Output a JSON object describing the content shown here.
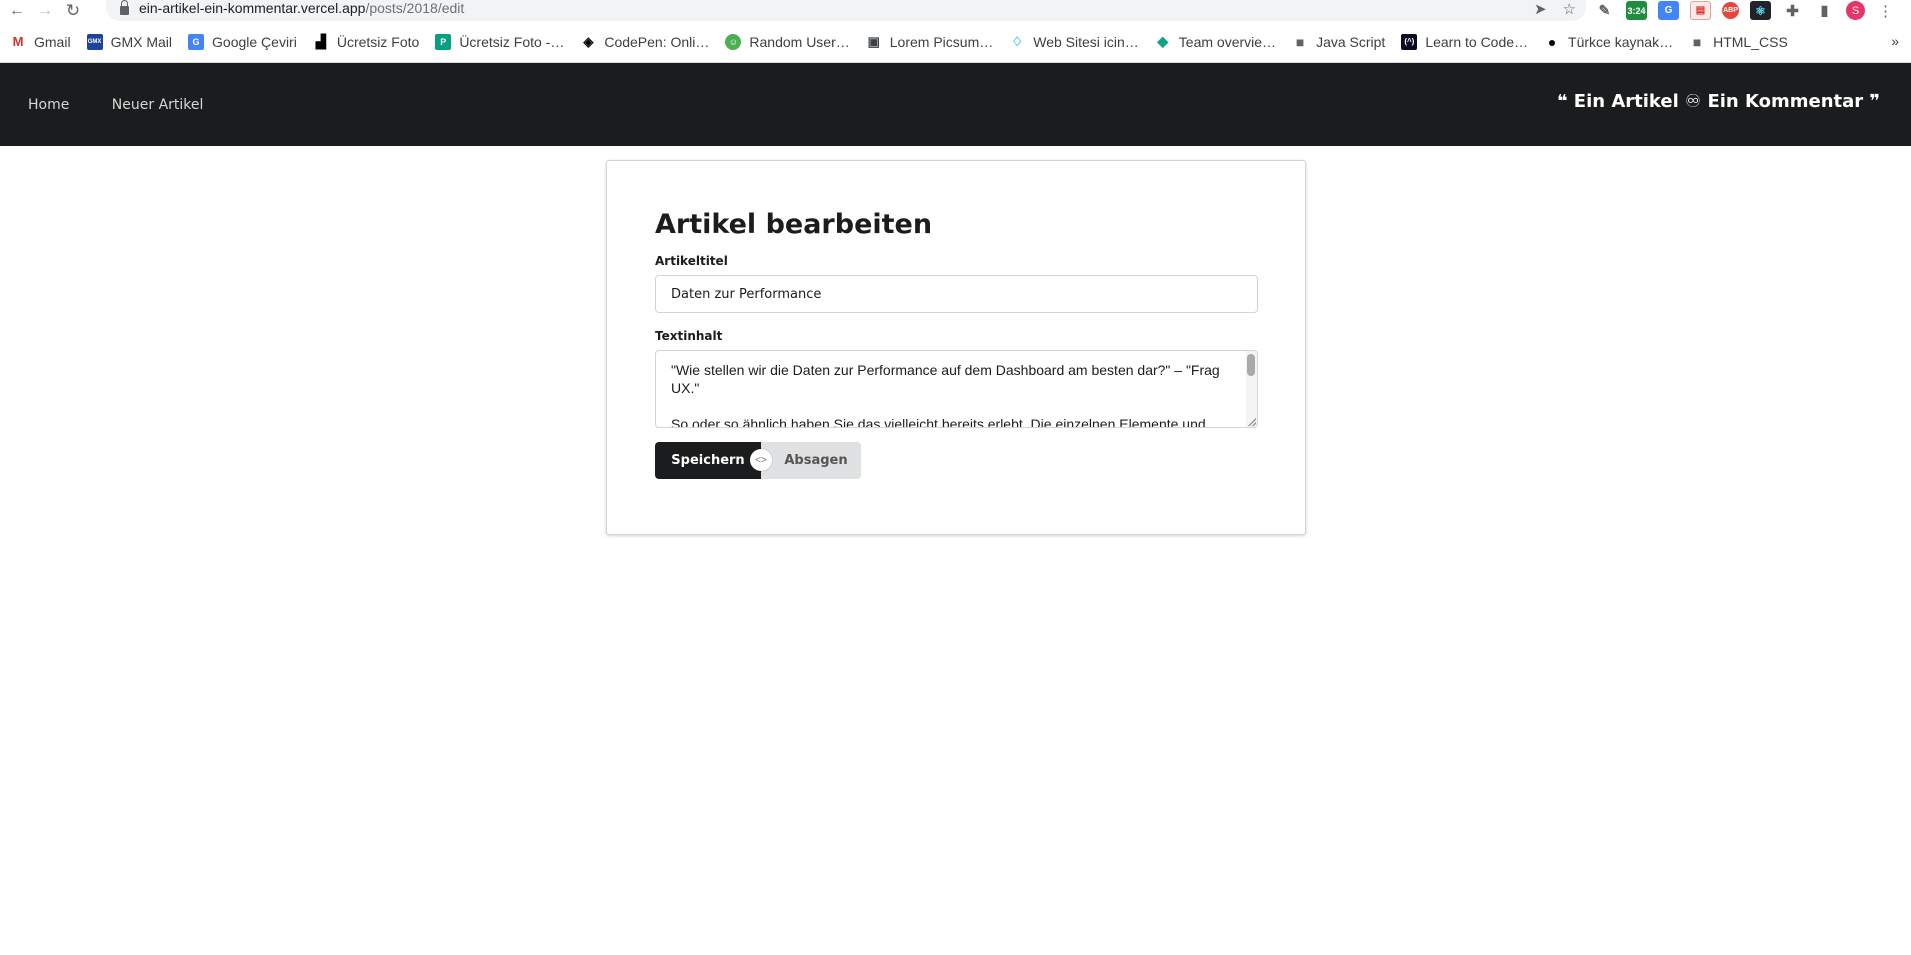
{
  "browser": {
    "url_host": "ein-artikel-ein-kommentar.vercel.app",
    "url_path": "/posts/2018/edit",
    "calendar_badge": "3:24",
    "abp_badge": "ABP",
    "avatar_letter": "S",
    "bookmarks": [
      {
        "label": "Gmail",
        "icon": "gmail-icon"
      },
      {
        "label": "GMX Mail",
        "icon": "gmx-icon"
      },
      {
        "label": "Google Çeviri",
        "icon": "google-translate-icon"
      },
      {
        "label": "Ücretsiz Foto",
        "icon": "unsplash-icon"
      },
      {
        "label": "Ücretsiz Foto -…",
        "icon": "pexels-icon"
      },
      {
        "label": "CodePen: Onli…",
        "icon": "codepen-icon"
      },
      {
        "label": "Random User…",
        "icon": "random-user-icon"
      },
      {
        "label": "Lorem Picsum…",
        "icon": "image-icon"
      },
      {
        "label": "Web Sitesi icin…",
        "icon": "diamond-icon"
      },
      {
        "label": "Team overvie…",
        "icon": "team-icon"
      },
      {
        "label": "Java Script",
        "icon": "folder-icon"
      },
      {
        "label": "Learn to Code…",
        "icon": "freecodecamp-icon"
      },
      {
        "label": "Türkce kaynak…",
        "icon": "github-icon"
      },
      {
        "label": "HTML_CSS",
        "icon": "folder-icon"
      }
    ],
    "more_bookmarks": "»"
  },
  "site": {
    "nav": {
      "home": "Home",
      "new_article": "Neuer Artikel"
    },
    "brand": "❝ Ein Artikel ♾ Ein Kommentar ❞"
  },
  "form": {
    "heading": "Artikel bearbeiten",
    "title_label": "Artikeltitel",
    "title_value": "Daten zur Performance",
    "content_label": "Textinhalt",
    "content_paragraphs": [
      "\"Wie stellen wir die Daten zur Performance auf dem Dashboard am besten dar?\" – \"Frag UX.\"",
      "So oder so ähnlich haben Sie das vielleicht bereits erlebt. Die einzelnen Elemente und"
    ],
    "save_label": "Speichern",
    "or_label": "<>",
    "cancel_label": "Absagen"
  },
  "colors": {
    "header_bg": "#1b1c1d",
    "primary_button": "#1b1c1d",
    "secondary_button": "#e0e1e2"
  }
}
